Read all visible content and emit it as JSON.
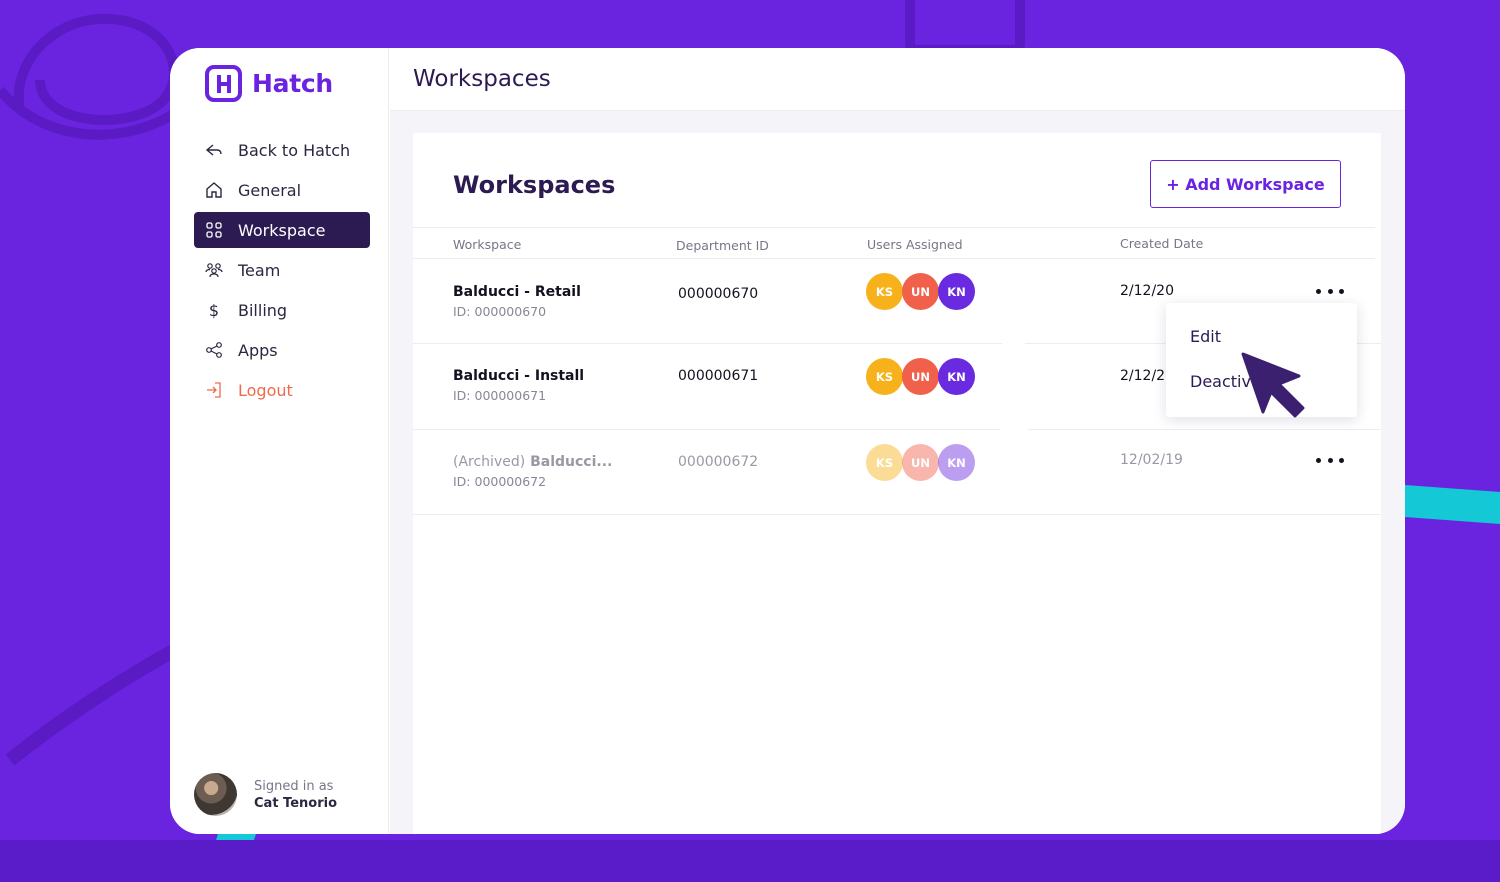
{
  "brand": {
    "name": "Hatch"
  },
  "sidebar": {
    "items": [
      {
        "label": "Back to Hatch",
        "icon": "back-arrow-icon"
      },
      {
        "label": "General",
        "icon": "home-icon"
      },
      {
        "label": "Workspace",
        "icon": "grid-icon",
        "active": true
      },
      {
        "label": "Team",
        "icon": "people-icon"
      },
      {
        "label": "Billing",
        "icon": "dollar-icon"
      },
      {
        "label": "Apps",
        "icon": "share-nodes-icon"
      },
      {
        "label": "Logout",
        "icon": "logout-icon"
      }
    ],
    "user": {
      "signed_in_label": "Signed in as",
      "name": "Cat Tenorio"
    }
  },
  "topbar": {
    "title": "Workspaces"
  },
  "card": {
    "title": "Workspaces",
    "add_button": "+ Add Workspace",
    "columns": [
      "Workspace",
      "Department ID",
      "Users Assigned",
      "Created Date"
    ],
    "rows": [
      {
        "name": "Balducci - Retail",
        "id": "ID: 000000670",
        "department_id": "000000670",
        "users": [
          "KS",
          "UN",
          "KN"
        ],
        "created": "2/12/20",
        "archived": false
      },
      {
        "name": "Balducci - Install",
        "id": "ID: 000000671",
        "department_id": "000000671",
        "users": [
          "KS",
          "UN",
          "KN"
        ],
        "created": "2/12/2",
        "archived": false
      },
      {
        "prefix": "(Archived)",
        "name": "Balducci...",
        "id": "ID: 000000672",
        "department_id": "000000672",
        "users": [
          "KS",
          "UN",
          "KN"
        ],
        "created": "12/02/19",
        "archived": true
      }
    ],
    "avatar_colors": {
      "KS": "#f7b21b",
      "UN": "#f0604a",
      "KN": "#6a2ae0"
    }
  },
  "context_menu": {
    "items": [
      "Edit",
      "Deactiv"
    ]
  },
  "colors": {
    "brand": "#6a24e0",
    "active_nav": "#2c1b52",
    "logout": "#f06a4a",
    "accent_teal": "#14c8d6"
  }
}
